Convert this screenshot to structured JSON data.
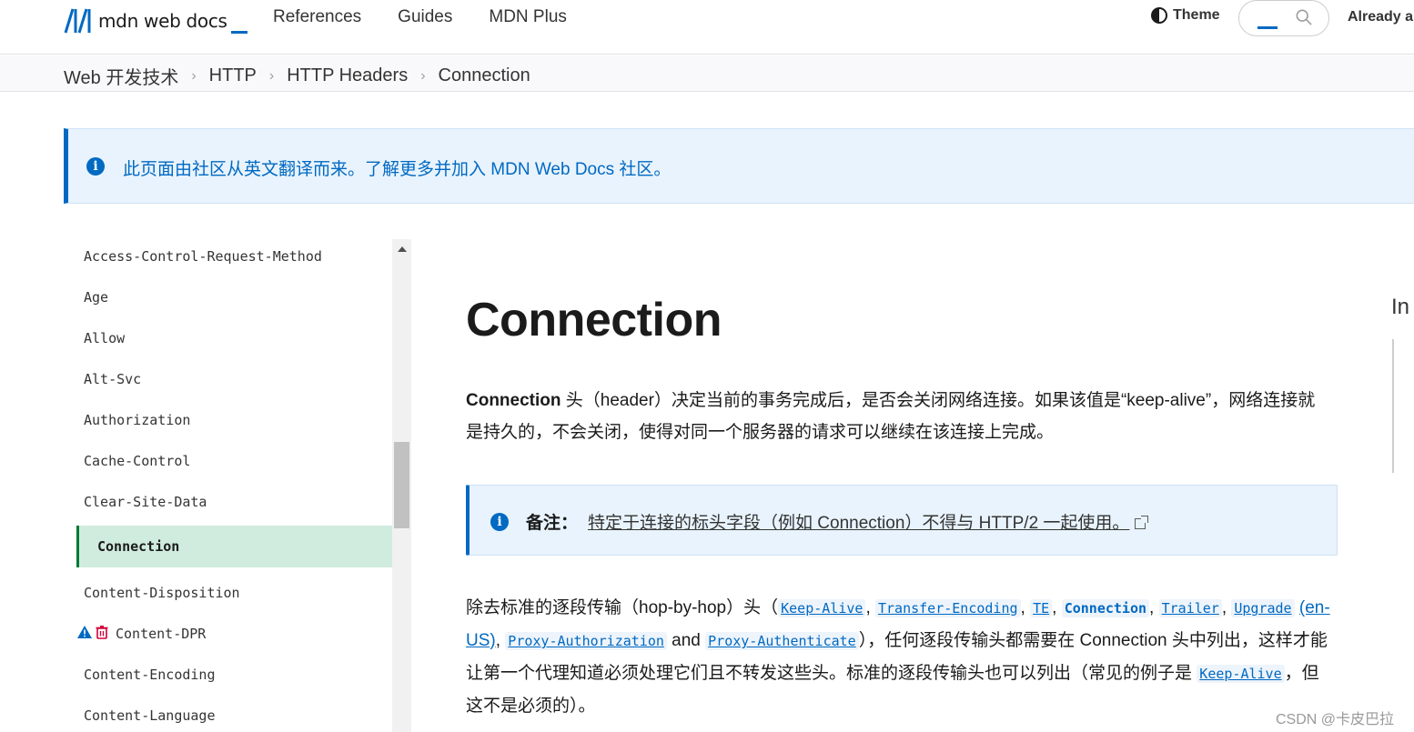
{
  "header": {
    "logo_text": "mdn web docs",
    "nav": [
      "References",
      "Guides",
      "MDN Plus"
    ],
    "theme_label": "Theme",
    "account_label": "Already a"
  },
  "breadcrumb": [
    "Web 开发技术",
    "HTTP",
    "HTTP Headers",
    "Connection"
  ],
  "notice": {
    "text": "此页面由社区从英文翻译而来。了解更多并加入 MDN Web Docs 社区。"
  },
  "sidebar": {
    "items": [
      "Access-Control-Request-Method",
      "Age",
      "Allow",
      "Alt-Svc",
      "Authorization",
      "Cache-Control",
      "Clear-Site-Data",
      "Connection",
      "Content-Disposition",
      "Content-DPR",
      "Content-Encoding",
      "Content-Language"
    ],
    "active": "Connection"
  },
  "main": {
    "title": "Connection",
    "intro_term": "Connection",
    "intro_rest": " 头（header）决定当前的事务完成后，是否会关闭网络连接。如果该值是“keep-alive”，网络连接就是持久的，不会关闭，使得对同一个服务器的请求可以继续在该连接上完成。",
    "note_label": "备注：",
    "note_link": "特定于连接的标头字段（例如 Connection）不得与 HTTP/2 一起使用。",
    "p2_start": "除去标准的逐段传输（hop-by-hop）头（",
    "p2_links": [
      "Keep-Alive",
      "Transfer-Encoding",
      "TE",
      "Connection",
      "Trailer",
      "Upgrade",
      "Proxy-Authorization",
      "Proxy-Authenticate"
    ],
    "p2_en_us": "(en-US)",
    "p2_and": "and",
    "p2_mid": "），任何逐段传输头都需要在 Connection 头中列出，这样才能让第一个代理知道必须处理它们且不转发这些头。标准的逐段传输头也可以列出（常见的例子是",
    "p2_example": "Keep-Alive",
    "p2_end": "，但这不是必须的）。"
  },
  "toc": {
    "title": "In"
  },
  "watermark": "CSDN @卡皮巴拉",
  "colors": {
    "accent": "#0069c2",
    "active_bg": "#d0ecde",
    "active_border": "#007936",
    "notice_bg": "#e8f3fd"
  }
}
